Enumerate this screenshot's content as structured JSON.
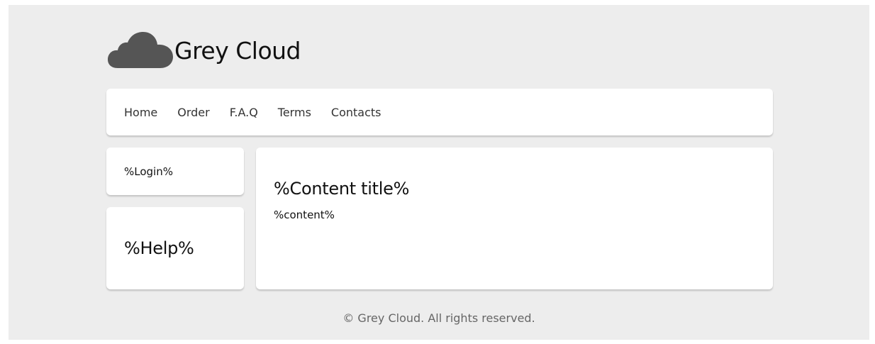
{
  "header": {
    "logo_icon": "cloud-icon",
    "site_title": "Grey Cloud"
  },
  "nav": {
    "items": [
      {
        "label": "Home"
      },
      {
        "label": "Order"
      },
      {
        "label": "F.A.Q"
      },
      {
        "label": "Terms"
      },
      {
        "label": "Contacts"
      }
    ]
  },
  "sidebar": {
    "login_text": "%Login%",
    "help_text": "%Help%"
  },
  "main": {
    "title": "%Content title%",
    "body": "%content%"
  },
  "footer": {
    "text": "© Grey Cloud. All rights reserved."
  },
  "colors": {
    "background": "#ededed",
    "card": "#ffffff",
    "logo": "#555555",
    "text": "#111111",
    "muted": "#666666"
  }
}
